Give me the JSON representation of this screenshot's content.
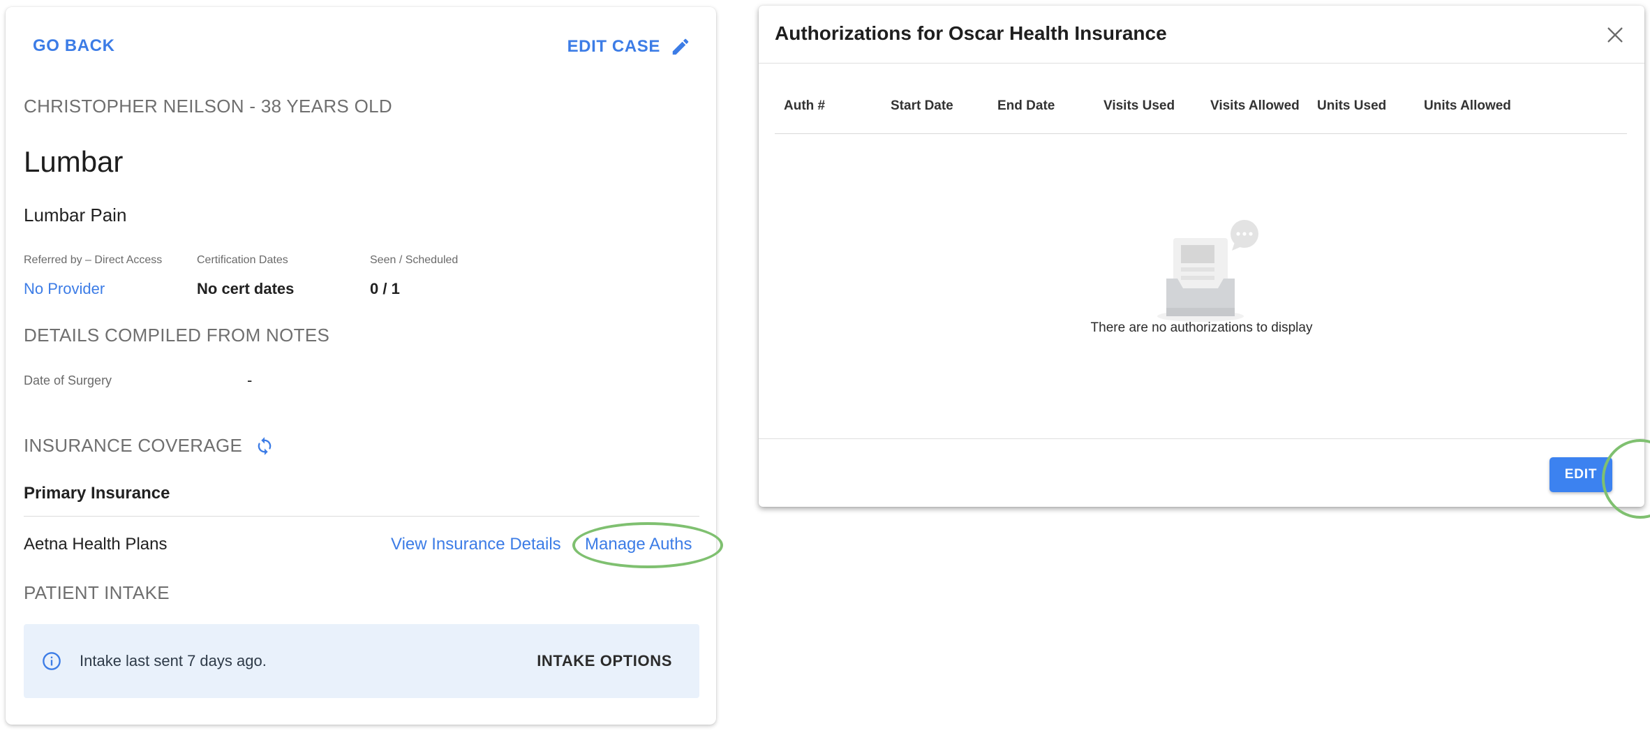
{
  "case_card": {
    "go_back_label": "GO BACK",
    "edit_case_label": "EDIT CASE",
    "patient_line": "CHRISTOPHER NEILSON - 38 YEARS OLD",
    "case_title": "Lumbar",
    "diagnosis": "Lumbar Pain",
    "referred": {
      "label": "Referred by – Direct Access",
      "value": "No Provider"
    },
    "certification": {
      "label": "Certification Dates",
      "value": "No cert dates"
    },
    "seen": {
      "label": "Seen / Scheduled",
      "value": "0 / 1"
    },
    "details_heading": "DETAILS COMPILED FROM NOTES",
    "date_of_surgery": {
      "label": "Date of Surgery",
      "value": "-"
    },
    "insurance_heading": "INSURANCE COVERAGE",
    "primary_insurance_label": "Primary Insurance",
    "insurance_name": "Aetna Health Plans",
    "view_insurance_label": "View Insurance Details",
    "manage_auths_label": "Manage Auths",
    "intake_heading": "PATIENT INTAKE",
    "intake_message": "Intake last sent 7 days ago.",
    "intake_options_label": "INTAKE OPTIONS"
  },
  "dialog": {
    "title": "Authorizations for Oscar Health Insurance",
    "columns": [
      "Auth #",
      "Start Date",
      "End Date",
      "Visits Used",
      "Visits Allowed",
      "Units Used",
      "Units Allowed"
    ],
    "rows": [],
    "empty_message": "There are no authorizations to display",
    "edit_label": "EDIT"
  },
  "icons": {
    "edit_case": "pencil-icon",
    "refresh_insurance": "refresh-icon",
    "intake_info": "info-icon",
    "close_dialog": "close-icon",
    "empty_state": "empty-inbox-icon"
  },
  "colors": {
    "link_blue": "#3c7ce6",
    "primary_button": "#3c82f0",
    "banner_background": "#e9f1fb",
    "highlight_green": "#7fc070"
  }
}
